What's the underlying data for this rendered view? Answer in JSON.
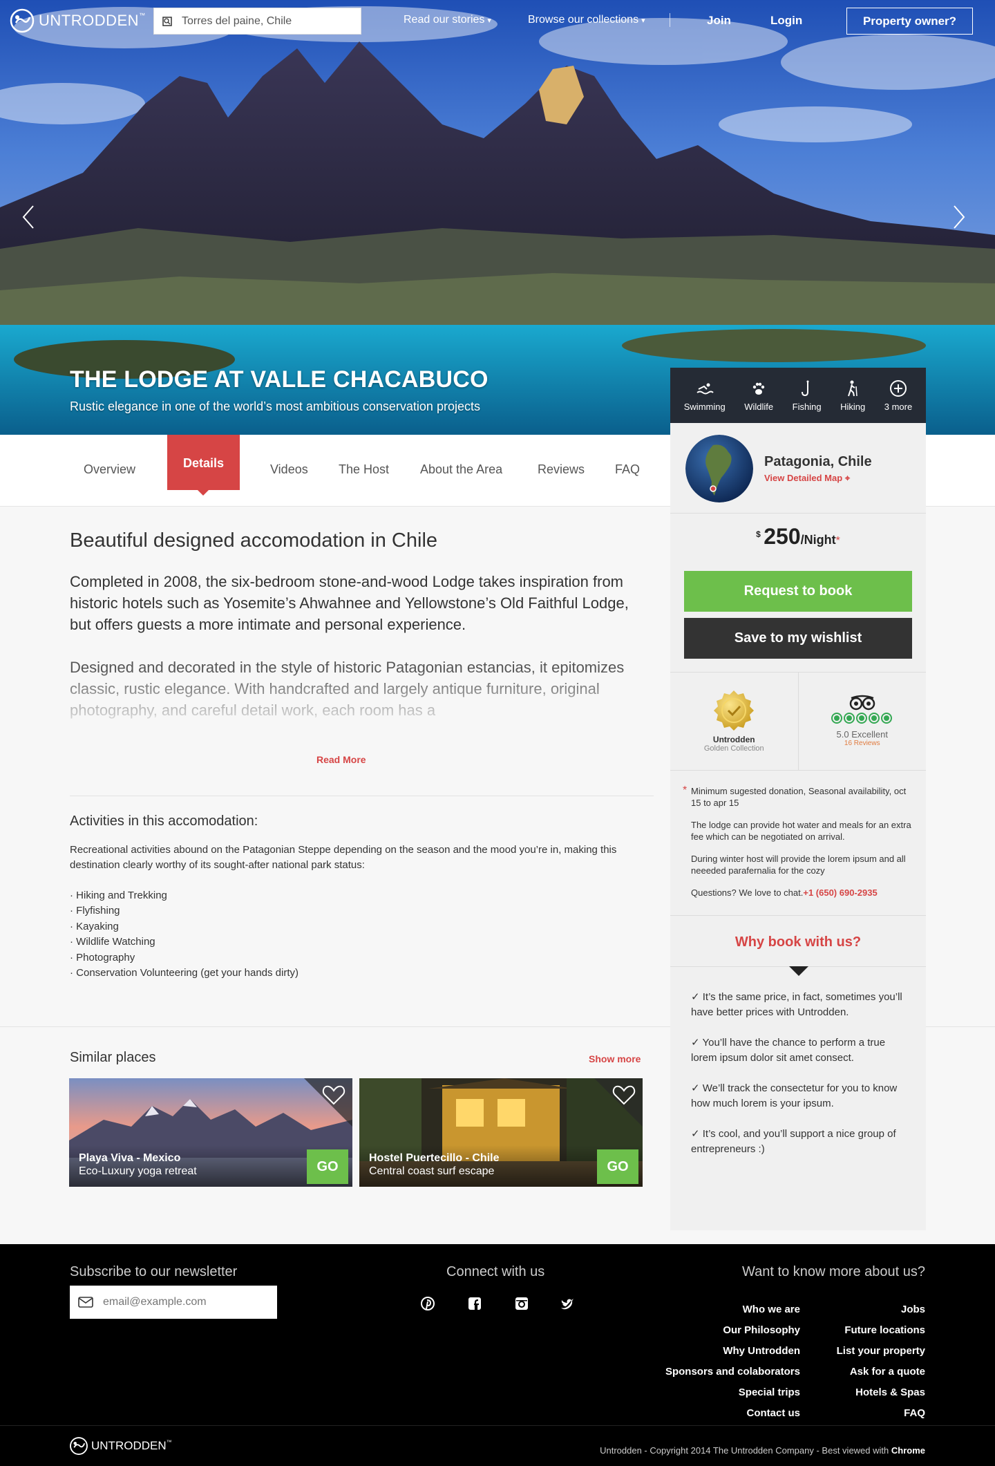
{
  "brand": {
    "name": "UNTRODDEN",
    "tm": "™"
  },
  "topnav": {
    "search_value": "Torres del paine, Chile",
    "stories": "Read our stories",
    "collections": "Browse our collections",
    "join": "Join",
    "login": "Login",
    "owner": "Property owner?"
  },
  "hero": {
    "title": "THE LODGE AT VALLE CHACABUCO",
    "subtitle": "Rustic elegance in one of the world’s most ambitious conservation projects"
  },
  "amenities": [
    {
      "label": "Swimming",
      "icon": "swimming-icon"
    },
    {
      "label": "Wildlife",
      "icon": "paw-icon"
    },
    {
      "label": "Fishing",
      "icon": "fishing-hook-icon"
    },
    {
      "label": "Hiking",
      "icon": "hiker-icon"
    },
    {
      "label": "3 more",
      "icon": "plus-circle-icon"
    }
  ],
  "tabs": [
    "Overview",
    "Details",
    "Videos",
    "The Host",
    "About the Area",
    "Reviews",
    "FAQ"
  ],
  "location": {
    "name": "Patagonia, Chile",
    "map_link": "View Detailed Map"
  },
  "price": {
    "currency": "$",
    "amount": "250",
    "unit": "/Night",
    "asterisk": "*"
  },
  "buttons": {
    "request": "Request to book",
    "wishlist": "Save to my wishlist"
  },
  "badges": {
    "collection_title": "Untrodden",
    "collection_sub": "Golden Collection",
    "rating": "5.0 Excellent",
    "reviews": "16 Reviews"
  },
  "notes": {
    "n1": "Minimum sugested donation, Seasonal availability, oct 15 to apr 15",
    "n2": "The lodge can provide hot water and meals for an extra fee which can be negotiated on arrival.",
    "n3": "During winter host will provide the lorem ipsum and all neeeded parafernalia for the cozy",
    "n4": "Questions? We love to chat.",
    "phone": "+1 (650) 690-2935"
  },
  "why": {
    "title": "Why book with us?",
    "items": [
      "It’s the same price, in fact, sometimes you’ll have better prices with Untrodden.",
      "You’ll have the chance to perform a true lorem ipsum dolor sit amet consect.",
      "We’ll track the consectetur for you to know how much lorem is your ipsum.",
      "It’s cool, and you’ll support a nice group of entrepreneurs :)"
    ]
  },
  "content": {
    "heading": "Beautiful designed accomodation in Chile",
    "lead": "Completed in 2008, the six-bedroom stone-and-wood Lodge takes inspiration from historic hotels such as Yosemite’s Ahwahnee and Yellowstone’s Old Faithful Lodge, but offers guests a more intimate and personal experience.",
    "lead2": "Designed and decorated in the style of historic Patagonian estancias, it epitomizes classic, rustic elegance. With handcrafted and largely antique furniture, original photography, and careful detail work, each room has a",
    "read_more": "Read More",
    "activities_heading": "Activities in this accomodation:",
    "activities_intro": "Recreational activities abound on the Patagonian Steppe depending on the season and the mood you’re in, making this destination clearly worthy of its sought-after national park status:",
    "activities": [
      "· Hiking and Trekking",
      "· Flyfishing",
      "· Kayaking",
      "· Wildlife Watching",
      "· Photography",
      "· Conservation Volunteering (get your hands dirty)"
    ]
  },
  "similar": {
    "heading": "Similar places",
    "show_more": "Show more",
    "go": "GO",
    "cards": [
      {
        "title": "Playa Viva - Mexico",
        "subtitle": "Eco-Luxury yoga retreat"
      },
      {
        "title": "Hostel Puertecillo - Chile",
        "subtitle": "Central coast surf escape"
      }
    ]
  },
  "footer": {
    "newsletter": "Subscribe to our newsletter",
    "email_placeholder": "email@example.com",
    "connect": "Connect with us",
    "more": "Want to know more about us?",
    "links_left": [
      "Who we are",
      "Our Philosophy",
      "Why Untrodden",
      "Sponsors and colaborators",
      "Special trips",
      "Contact us"
    ],
    "links_right": [
      "Jobs",
      "Future locations",
      "List your property",
      "Ask for a quote",
      "Hotels & Spas",
      "FAQ"
    ],
    "copyright": "Untrodden - Copyright 2014 The Untrodden Company - Best viewed with",
    "browser": "Chrome"
  },
  "colors": {
    "accent": "#d64545",
    "green": "#6dbf4b",
    "dark": "#333333"
  }
}
